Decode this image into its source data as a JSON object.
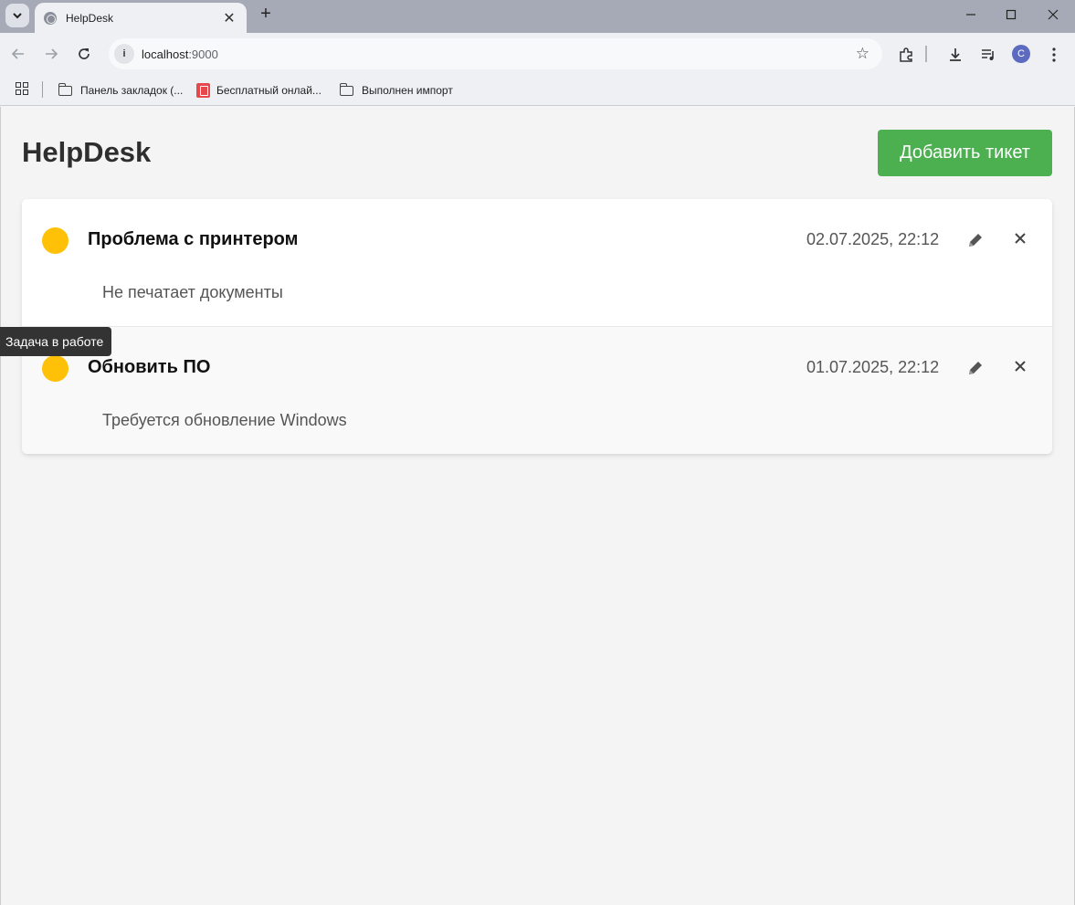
{
  "browser": {
    "tab_title": "HelpDesk",
    "tab_close": "✕",
    "new_tab": "+",
    "url_host": "localhost",
    "url_port": ":9000",
    "profile_initial": "C",
    "bookmarks": [
      {
        "label": "Панель закладок (...",
        "icon": "folder-icon"
      },
      {
        "label": "Бесплатный онлай...",
        "icon": "pdf-icon"
      },
      {
        "label": "Выполнен импорт",
        "icon": "folder-icon"
      }
    ]
  },
  "app": {
    "title": "HelpDesk",
    "add_button_label": "Добавить тикет",
    "status_color": "#ffc107",
    "accent_color": "#4caf50"
  },
  "tickets": [
    {
      "name": "Проблема с принтером",
      "date": "02.07.2025, 22:12",
      "description": "Не печатает документы",
      "status": "in-progress"
    },
    {
      "name": "Обновить ПО",
      "date": "01.07.2025, 22:12",
      "description": "Требуется обновление Windows",
      "status": "in-progress"
    }
  ],
  "tooltip": {
    "text": "Задача в работе"
  }
}
